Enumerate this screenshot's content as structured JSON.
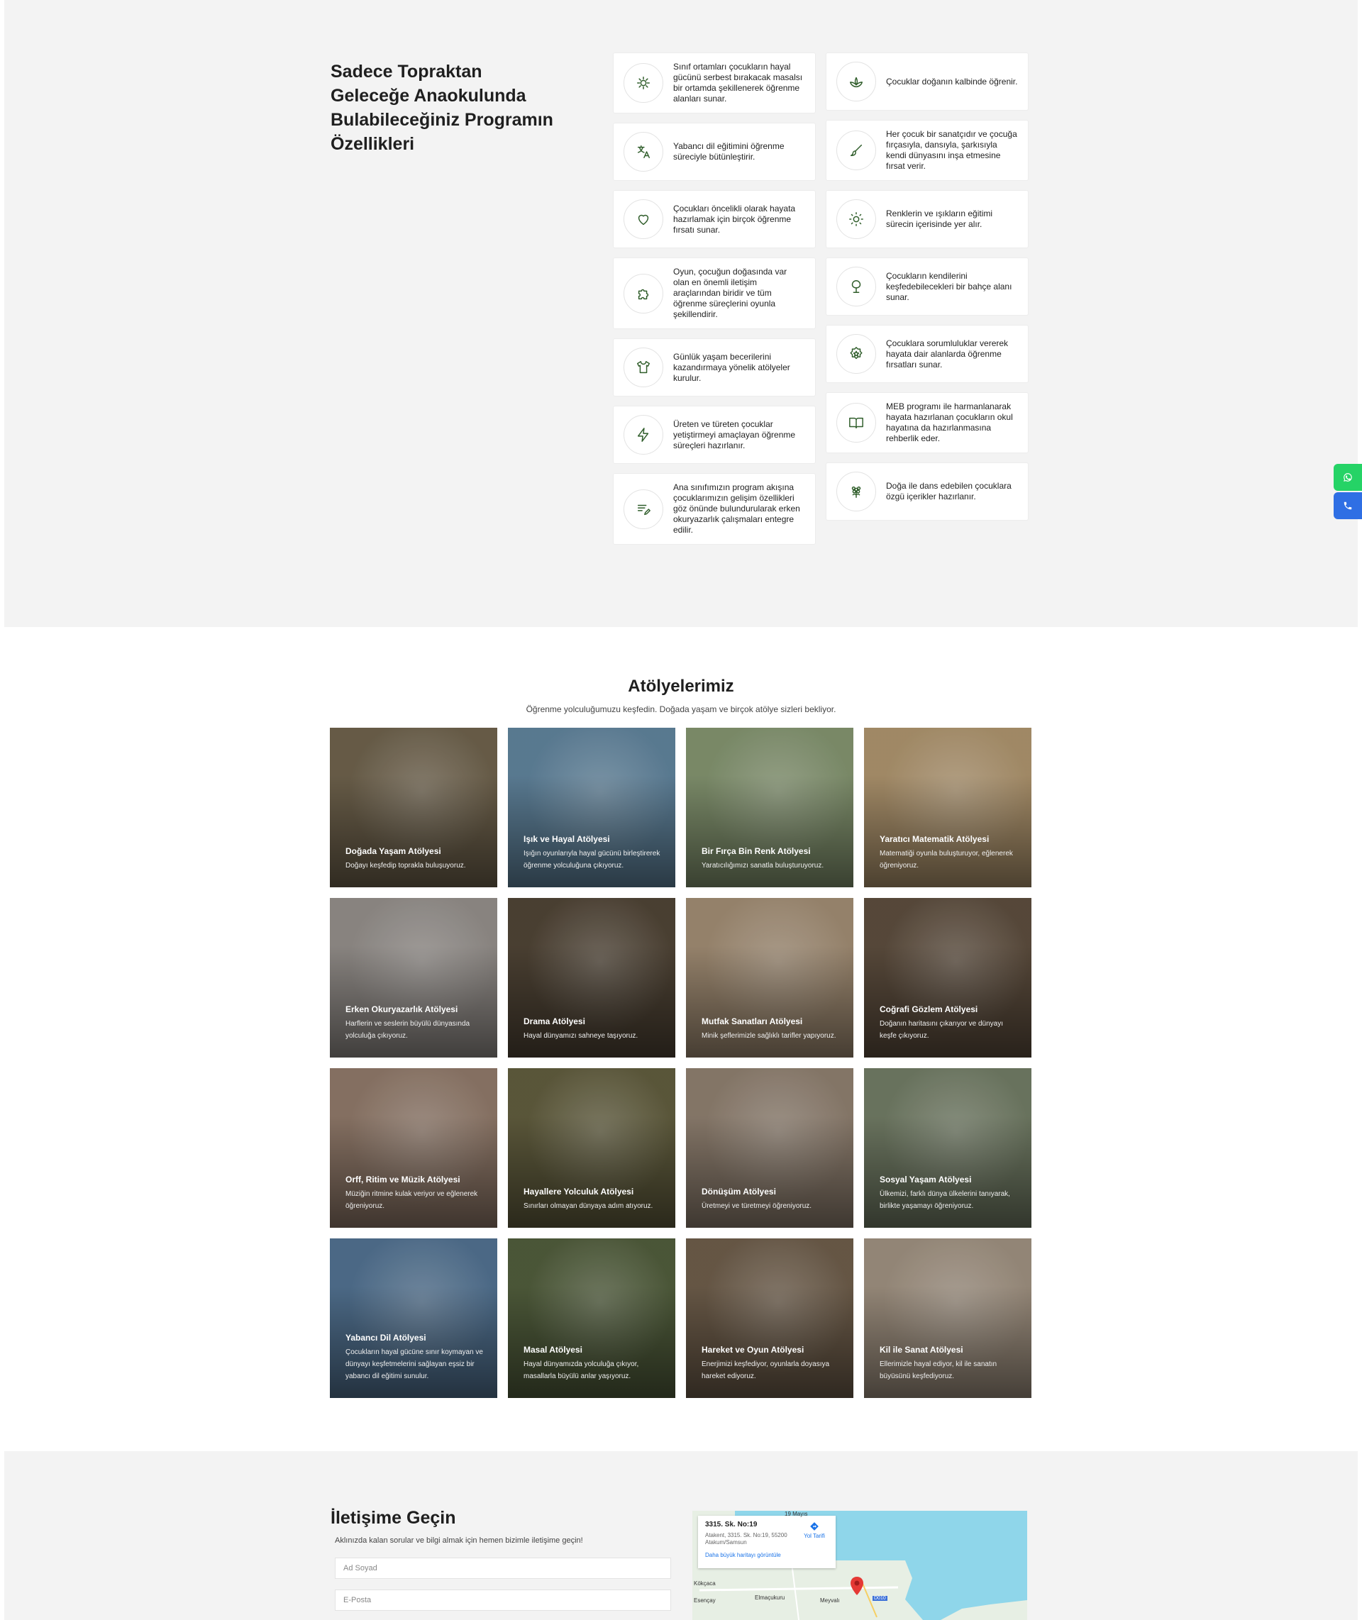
{
  "features": {
    "title": "Sadece Topraktan Geleceğe Anaokulunda Bulabileceğiniz Programın Özellikleri",
    "left": [
      {
        "icon": "sun-flower-icon",
        "text": "Sınıf ortamları çocukların hayal gücünü serbest bırakacak masalsı bir ortamda şekillenerek öğrenme alanları sunar."
      },
      {
        "icon": "translate-icon",
        "text": "Yabancı dil eğitimini öğrenme süreciyle bütünleştirir."
      },
      {
        "icon": "heart-icon",
        "text": "Çocukları öncelikli olarak hayata hazırlamak için birçok öğrenme fırsatı sunar."
      },
      {
        "icon": "puzzle-icon",
        "text": "Oyun, çocuğun doğasında var olan en önemli iletişim araçlarından biridir ve tüm öğrenme süreçlerini oyunla şekillendirir."
      },
      {
        "icon": "shirt-icon",
        "text": "Günlük yaşam becerilerini kazandırmaya yönelik atölyeler kurulur."
      },
      {
        "icon": "bolt-icon",
        "text": "Üreten ve türeten çocuklar yetiştirmeyi amaçlayan öğrenme süreçleri hazırlanır."
      },
      {
        "icon": "write-icon",
        "text": "Ana sınıfımızın program akışına çocuklarımızın gelişim özellikleri göz önünde bulundurularak erken okuryazarlık çalışmaları entegre edilir."
      }
    ],
    "right": [
      {
        "icon": "lotus-icon",
        "text": "Çocuklar doğanın kalbinde öğrenir."
      },
      {
        "icon": "brush-icon",
        "text": "Her çocuk bir sanatçıdır ve çocuğa fırçasıyla, dansıyla, şarkısıyla kendi dünyasını inşa etmesine fırsat verir."
      },
      {
        "icon": "sun-icon",
        "text": "Renklerin ve ışıkların eğitimi sürecin içerisinde yer alır."
      },
      {
        "icon": "tree-icon",
        "text": "Çocukların kendilerini keşfedebilecekleri bir bahçe alanı sunar."
      },
      {
        "icon": "badge-star-icon",
        "text": "Çocuklara sorumluluklar vererek hayata dair alanlarda öğrenme fırsatları sunar."
      },
      {
        "icon": "book-icon",
        "text": "MEB programı ile harmanlanarak hayata hazırlanan çocukların okul hayatına da hazırlanmasına rehberlik eder."
      },
      {
        "icon": "flower-icon",
        "text": "Doğa ile dans edebilen çocuklara özgü içerikler hazırlanır."
      }
    ]
  },
  "workshops": {
    "title": "Atölyelerimiz",
    "subtitle": "Öğrenme yolculuğumuzu keşfedin. Doğada yaşam ve birçok atölye sizleri bekliyor.",
    "items": [
      {
        "name": "Doğada Yaşam Atölyesi",
        "desc": "Doğayı keşfedip toprakla buluşuyoruz.",
        "color": "#6b5f4a"
      },
      {
        "name": "Işık ve Hayal Atölyesi",
        "desc": "Işığın oyunlarıyla hayal gücünü birleştirerek öğrenme yolculuğuna çıkıyoruz.",
        "color": "#5d7f97"
      },
      {
        "name": "Bir Fırça Bin Renk Atölyesi",
        "desc": "Yaratıcılığımızı sanatla buluşturuyoruz.",
        "color": "#7f8f6c"
      },
      {
        "name": "Yaratıcı Matematik Atölyesi",
        "desc": "Matematiği oyunla buluşturuyor, eğlenerek öğreniyoruz.",
        "color": "#a88f6a"
      },
      {
        "name": "Erken Okuryazarlık Atölyesi",
        "desc": "Harflerin ve seslerin büyülü dünyasında yolculuğa çıkıyoruz.",
        "color": "#8f8a86"
      },
      {
        "name": "Drama Atölyesi",
        "desc": "Hayal dünyamızı sahneye taşıyoruz.",
        "color": "#4d4234"
      },
      {
        "name": "Mutfak Sanatları Atölyesi",
        "desc": "Minik şeflerimizle sağlıklı tarifler yapıyoruz.",
        "color": "#9c8870"
      },
      {
        "name": "Coğrafi Gözlem Atölyesi",
        "desc": "Doğanın haritasını çıkarıyor ve dünyayı keşfe çıkıyoruz.",
        "color": "#5a4b3c"
      },
      {
        "name": "Orff, Ritim ve Müzik Atölyesi",
        "desc": "Müziğin ritmine kulak veriyor ve eğlenerek öğreniyoruz.",
        "color": "#8b7566"
      },
      {
        "name": "Hayallere Yolculuk Atölyesi",
        "desc": "Sınırları olmayan dünyaya adım atıyoruz.",
        "color": "#5e5a3c"
      },
      {
        "name": "Dönüşüm Atölyesi",
        "desc": "Üretmeyi ve türetmeyi öğreniyoruz.",
        "color": "#8a7b6c"
      },
      {
        "name": "Sosyal Yaşam Atölyesi",
        "desc": "Ülkemizi, farklı dünya ülkelerini tanıyarak, birlikte yaşamayı öğreniyoruz.",
        "color": "#6e7862"
      },
      {
        "name": "Yabancı Dil Atölyesi",
        "desc": "Çocukların hayal gücüne sınır koymayan ve dünyayı keşfetmelerini sağlayan eşsiz bir yabancı dil eğitimi sunulur.",
        "color": "#4f6e8c"
      },
      {
        "name": "Masal Atölyesi",
        "desc": "Hayal dünyamızda yolculuğa çıkıyor, masallarla büyülü anlar yaşıyoruz.",
        "color": "#4e5a3a"
      },
      {
        "name": "Hareket ve Oyun Atölyesi",
        "desc": "Enerjimizi keşfediyor, oyunlarla doyasıya hareket ediyoruz.",
        "color": "#6a5a48"
      },
      {
        "name": "Kil ile Sanat Atölyesi",
        "desc": "Ellerimizle hayal ediyor, kil ile sanatın büyüsünü keşfediyoruz.",
        "color": "#9a8c7c"
      }
    ]
  },
  "contact": {
    "title": "İletişime Geçin",
    "subtitle": "Aklınızda kalan sorular ve bilgi almak için hemen bizimle iletişime geçin!",
    "name_placeholder": "Ad Soyad",
    "email_placeholder": "E-Posta"
  },
  "map": {
    "address_title": "3315. Sk. No:19",
    "address": "Atakent, 3315. Sk. No:19, 55200 Atakum/Samsun",
    "larger_map": "Daha büyük haritayı görüntüle",
    "directions": "Yol Tarifi",
    "labels": [
      "19 Mayıs",
      "Kökçaca",
      "Esençay",
      "Elmaçukuru",
      "Meyvalı",
      "D010"
    ]
  },
  "float_buttons": {
    "whatsapp_color": "#25d366",
    "phone_color": "#2f6fe4"
  }
}
